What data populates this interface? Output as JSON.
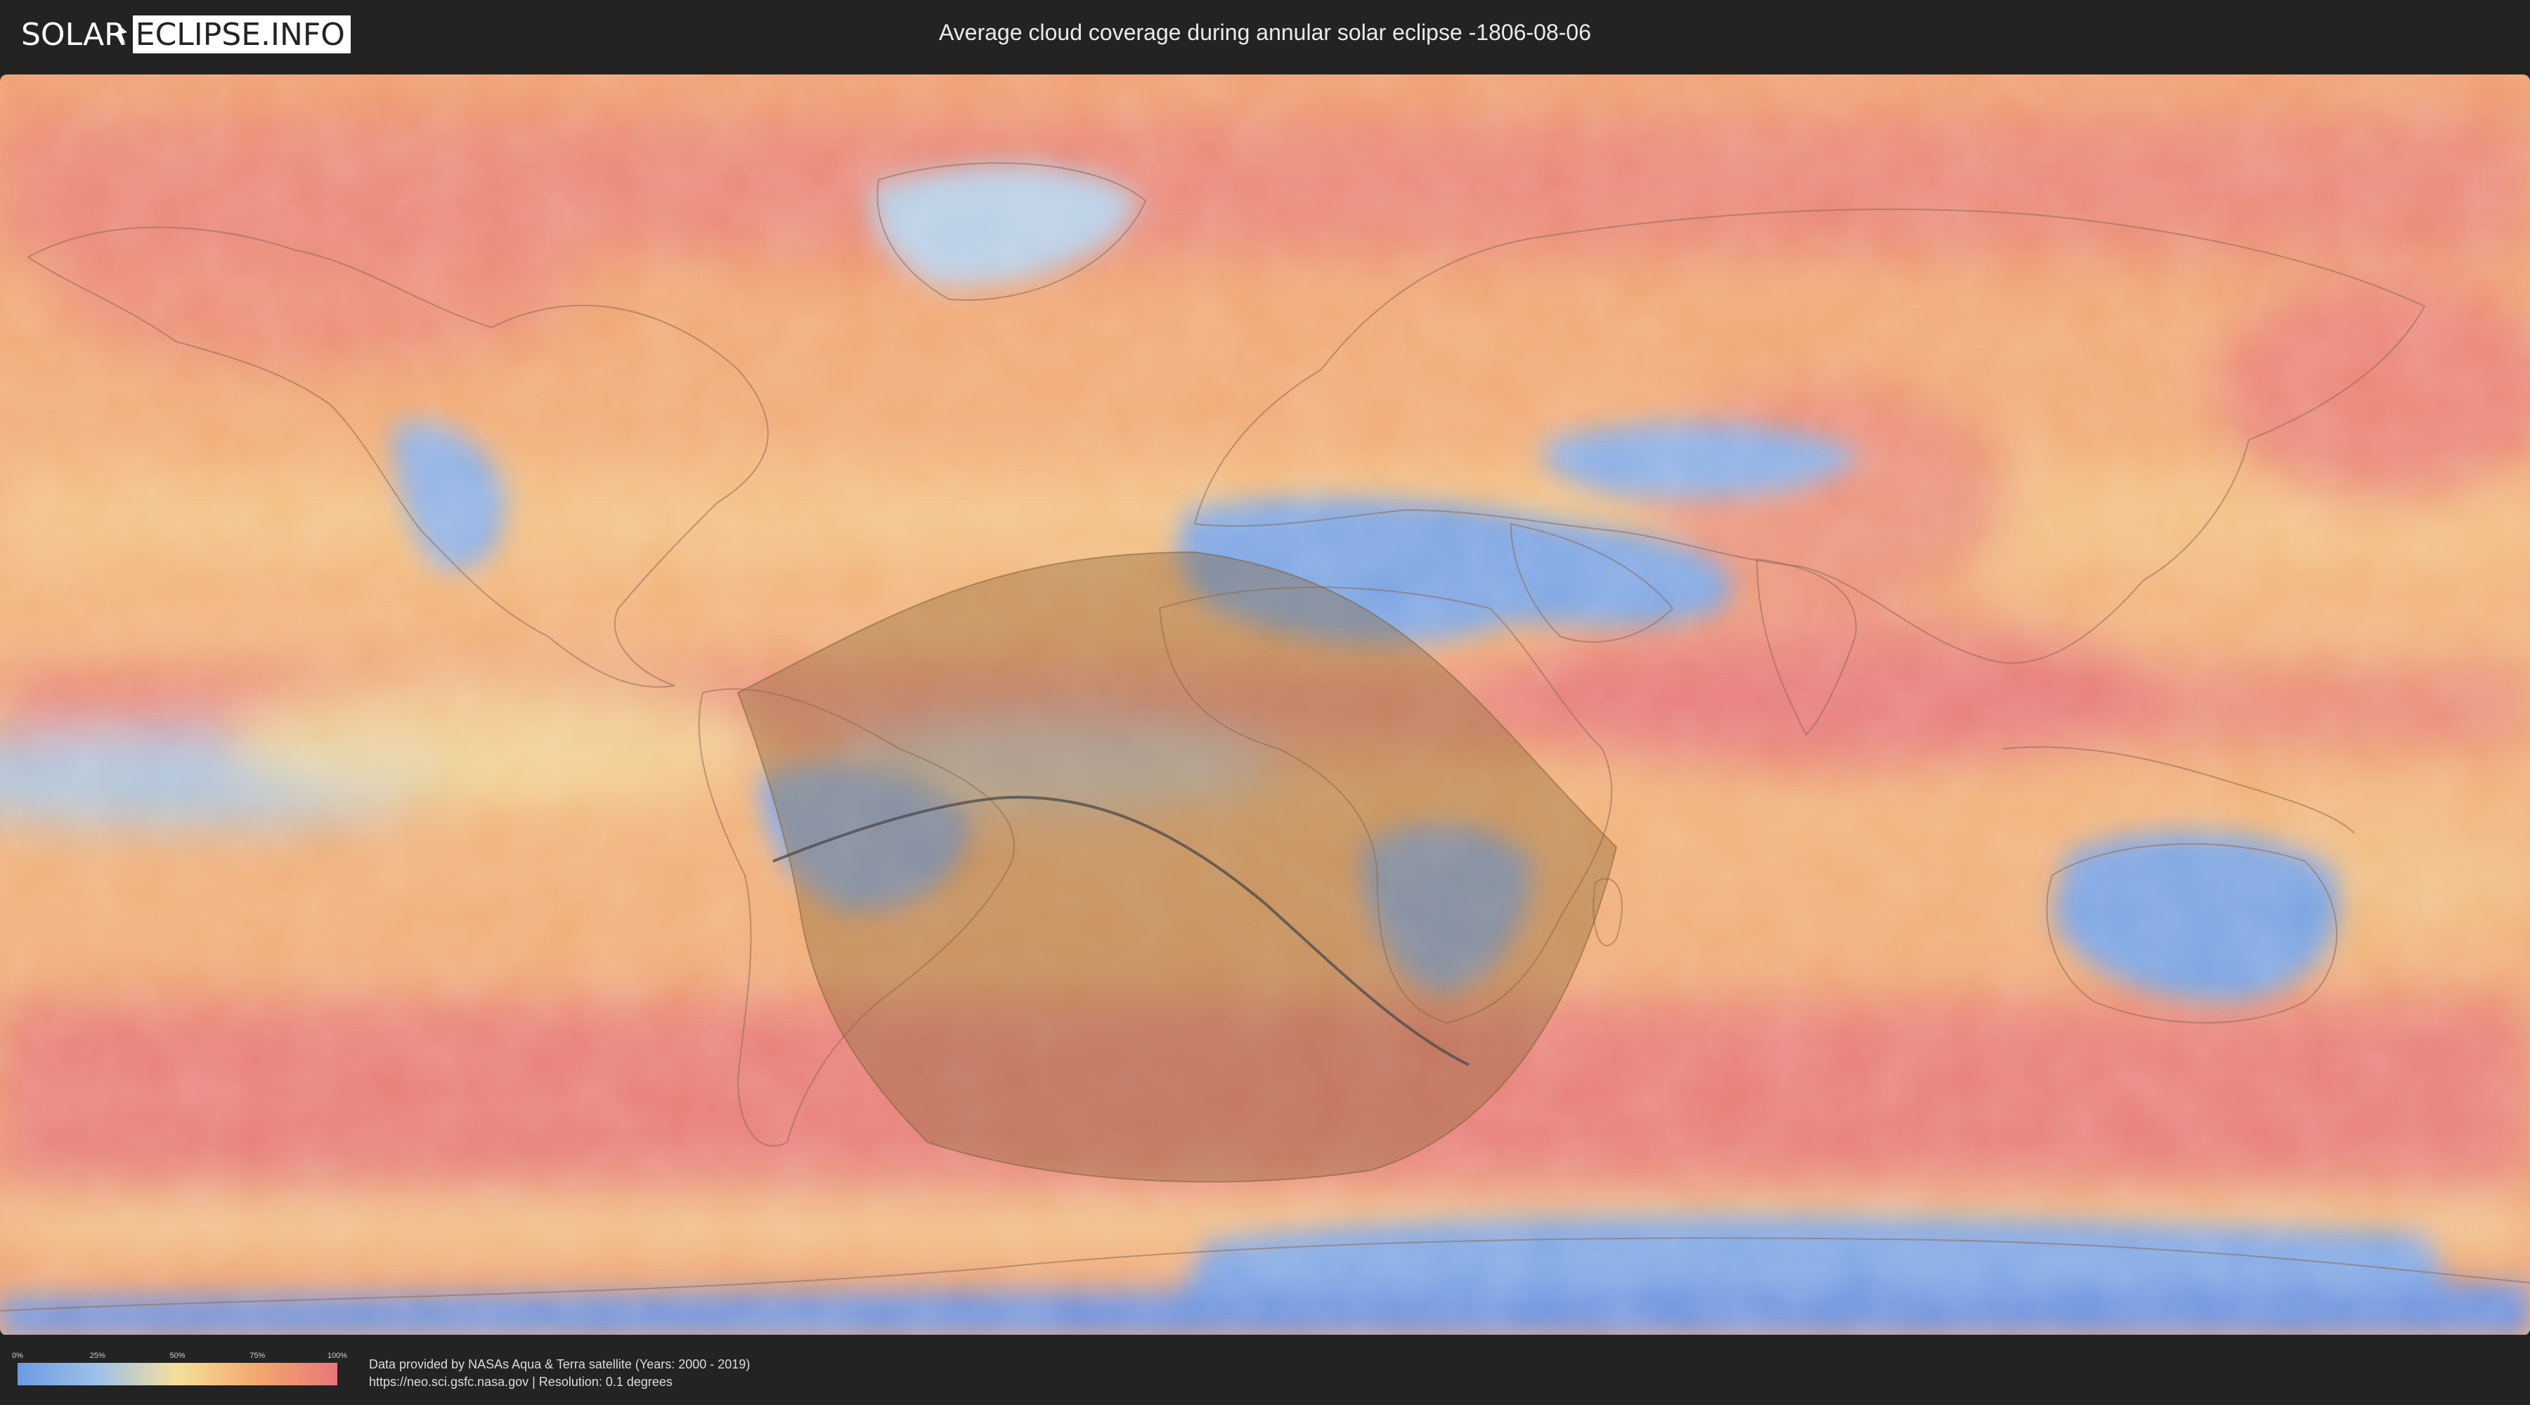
{
  "header": {
    "logo_left": "SOLAR",
    "logo_right": "ECLIPSE.INFO",
    "title": "Average cloud coverage during annular solar eclipse -1806-08-06"
  },
  "legend": {
    "ticks": [
      "0%",
      "25%",
      "50%",
      "75%",
      "100%"
    ],
    "colors": [
      "#6c9be2",
      "#9ec1e8",
      "#f5df9b",
      "#f2a86c",
      "#e9767a"
    ]
  },
  "credits": {
    "line1": "Data provided by NASAs Aqua & Terra satellite (Years: 2000 - 2019)",
    "line2": "https://neo.sci.gsfc.nasa.gov | Resolution: 0.1 degrees"
  },
  "map": {
    "projection": "equirectangular",
    "colors": {
      "clear": "#7aa5e6",
      "low": "#a9c7e6",
      "mid": "#f4d996",
      "high": "#f0a76d",
      "overcast": "#e57778",
      "eclipse_shadow": "#8b6a3a",
      "central_path": "#4a4a4a",
      "borders": "#8a6a55"
    }
  }
}
